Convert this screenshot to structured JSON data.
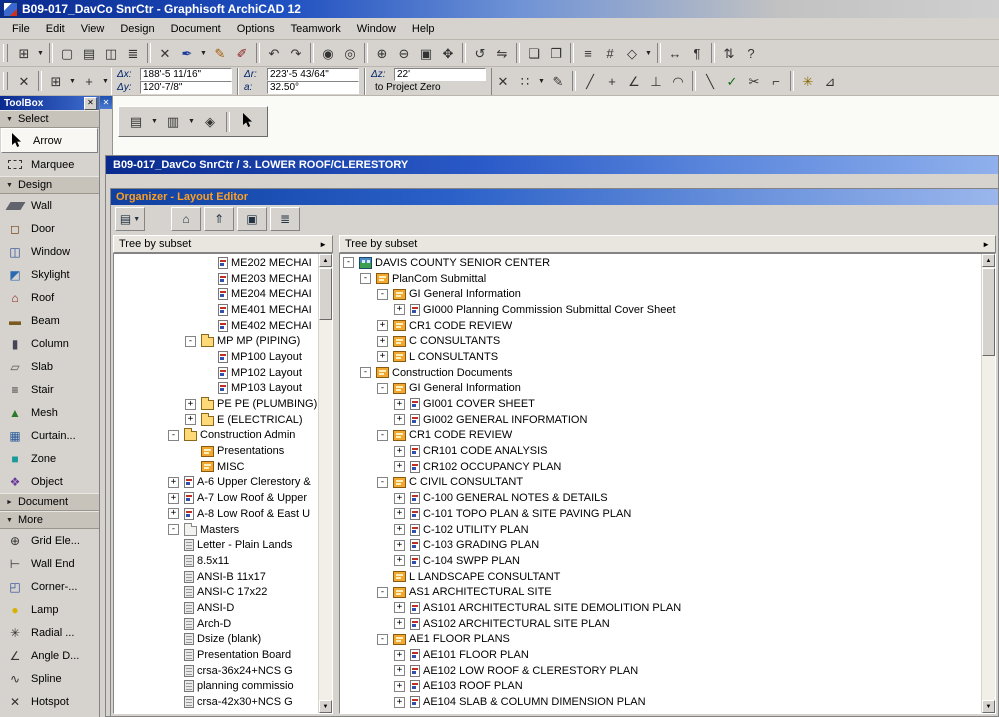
{
  "titlebar": {
    "title": "B09-017_DavCo SnrCtr - Graphisoft ArchiCAD 12"
  },
  "menubar": {
    "items": [
      "File",
      "Edit",
      "View",
      "Design",
      "Document",
      "Options",
      "Teamwork",
      "Window",
      "Help"
    ]
  },
  "toolbar_main": {
    "items": [
      {
        "icon": "favorites-grid-icon"
      },
      {
        "drop": true
      },
      {
        "sep": true
      },
      {
        "icon": "new-document-icon"
      },
      {
        "icon": "open-icon"
      },
      {
        "icon": "save-icon"
      },
      {
        "icon": "print-icon"
      },
      {
        "sep": true
      },
      {
        "icon": "delete-icon"
      },
      {
        "icon": "pen-color-icon"
      },
      {
        "drop": true
      },
      {
        "icon": "pencil-icon"
      },
      {
        "icon": "brush-icon"
      },
      {
        "sep": true
      },
      {
        "icon": "undo-icon"
      },
      {
        "icon": "redo-icon"
      },
      {
        "sep": true
      },
      {
        "icon": "pickup-parameters-icon"
      },
      {
        "icon": "inject-parameters-icon"
      },
      {
        "sep": true
      },
      {
        "icon": "zoom-in-icon"
      },
      {
        "icon": "zoom-out-icon"
      },
      {
        "icon": "fit-in-window-icon"
      },
      {
        "icon": "pan-icon"
      },
      {
        "sep": true
      },
      {
        "icon": "rotate-icon"
      },
      {
        "icon": "mirror-icon"
      },
      {
        "sep": true
      },
      {
        "icon": "group-icon"
      },
      {
        "icon": "ungroup-icon"
      },
      {
        "sep": true
      },
      {
        "icon": "layers-icon"
      },
      {
        "icon": "grid-icon"
      },
      {
        "icon": "snap-icon"
      },
      {
        "drop": true
      },
      {
        "sep": true
      },
      {
        "icon": "dimension-icon"
      },
      {
        "icon": "label-icon"
      },
      {
        "sep": true
      },
      {
        "icon": "teamwork-icon"
      },
      {
        "icon": "help-icon"
      }
    ]
  },
  "toolbar_coords": {
    "left_items": [
      {
        "icon": "close-icon"
      },
      {
        "sep": true
      },
      {
        "icon": "grid-snap-icon"
      },
      {
        "drop": true
      },
      {
        "icon": "plus-icon"
      },
      {
        "drop": true
      }
    ],
    "coord_boxes": [
      {
        "rows": [
          {
            "label": "Δx:",
            "value": "188'-5 11/16\""
          },
          {
            "label": "Δy:",
            "value": "120'-7/8\""
          }
        ]
      },
      {
        "rows": [
          {
            "label": "Δr:",
            "value": "223'-5 43/64\""
          },
          {
            "label": "a:",
            "value": "32.50°"
          }
        ]
      },
      {
        "rows": [
          {
            "label": "Δz:",
            "value": "22'"
          },
          {
            "label": "",
            "value": "to Project Zero",
            "plain": true
          }
        ]
      }
    ],
    "right_items": [
      {
        "icon": "cancel-icon"
      },
      {
        "icon": "snap-points-icon"
      },
      {
        "drop": true
      },
      {
        "icon": "pen-icon"
      },
      {
        "sep": true
      },
      {
        "icon": "guide-line-icon"
      },
      {
        "icon": "snap-point-icon"
      },
      {
        "icon": "angle-snap-icon"
      },
      {
        "icon": "perpendicular-icon"
      },
      {
        "icon": "tangent-icon"
      },
      {
        "sep": true
      },
      {
        "icon": "diagonal-icon"
      },
      {
        "icon": "ok-icon"
      },
      {
        "icon": "scissors-icon"
      },
      {
        "icon": "corner-icon"
      },
      {
        "sep": true
      },
      {
        "icon": "magic-wand-icon"
      },
      {
        "icon": "trim-icon"
      }
    ]
  },
  "mini_toolbar": {
    "items": [
      {
        "icon": "layout-settings-icon"
      },
      {
        "drop": true
      },
      {
        "icon": "master-layout-icon"
      },
      {
        "drop": true
      },
      {
        "icon": "update-icon"
      },
      {
        "sep": true
      },
      {
        "icon": "arrow-cursor-icon"
      }
    ]
  },
  "toolbox": {
    "title": "ToolBox",
    "items": [
      {
        "type": "header",
        "label": "Select"
      },
      {
        "type": "tool",
        "label": "Arrow",
        "icon": "arrow",
        "selected": true
      },
      {
        "type": "tool",
        "label": "Marquee",
        "icon": "marquee"
      },
      {
        "type": "header",
        "label": "Design"
      },
      {
        "type": "tool",
        "label": "Wall",
        "icon": "wall"
      },
      {
        "type": "tool",
        "label": "Door",
        "icon": "door"
      },
      {
        "type": "tool",
        "label": "Window",
        "icon": "window"
      },
      {
        "type": "tool",
        "label": "Skylight",
        "icon": "skylight"
      },
      {
        "type": "tool",
        "label": "Roof",
        "icon": "roof"
      },
      {
        "type": "tool",
        "label": "Beam",
        "icon": "beam"
      },
      {
        "type": "tool",
        "label": "Column",
        "icon": "column"
      },
      {
        "type": "tool",
        "label": "Slab",
        "icon": "slab"
      },
      {
        "type": "tool",
        "label": "Stair",
        "icon": "stair"
      },
      {
        "type": "tool",
        "label": "Mesh",
        "icon": "mesh"
      },
      {
        "type": "tool",
        "label": "Curtain...",
        "icon": "curtain"
      },
      {
        "type": "tool",
        "label": "Zone",
        "icon": "zone"
      },
      {
        "type": "tool",
        "label": "Object",
        "icon": "object"
      },
      {
        "type": "header",
        "label": "Document"
      },
      {
        "type": "header",
        "label": "More"
      },
      {
        "type": "tool",
        "label": "Grid Ele...",
        "icon": "grid-element"
      },
      {
        "type": "tool",
        "label": "Wall End",
        "icon": "wall-end"
      },
      {
        "type": "tool",
        "label": "Corner-...",
        "icon": "corner-window"
      },
      {
        "type": "tool",
        "label": "Lamp",
        "icon": "lamp"
      },
      {
        "type": "tool",
        "label": "Radial ...",
        "icon": "radial-dimension"
      },
      {
        "type": "tool",
        "label": "Angle D...",
        "icon": "angle-dimension"
      },
      {
        "type": "tool",
        "label": "Spline",
        "icon": "spline"
      },
      {
        "type": "tool",
        "label": "Hotspot",
        "icon": "hotspot"
      }
    ]
  },
  "document_window": {
    "title": "B09-017_DavCo SnrCtr / 3. LOWER ROOF/CLERESTORY"
  },
  "organizer": {
    "title": "Organizer - Layout Editor",
    "toolbar": {
      "items": [
        {
          "icon": "project-chooser-icon"
        },
        {
          "drop": true
        },
        {
          "gap": true
        },
        {
          "icon": "home-icon"
        },
        {
          "icon": "folder-up-icon"
        },
        {
          "icon": "new-folder-icon"
        },
        {
          "icon": "tree-view-icon"
        }
      ]
    },
    "left_panel": {
      "header": "Tree by subset",
      "items": [
        {
          "lvl": 5,
          "exp": "",
          "icon": "layout",
          "label": "ME202 MECHAI"
        },
        {
          "lvl": 5,
          "exp": "",
          "icon": "layout",
          "label": "ME203 MECHAI"
        },
        {
          "lvl": 5,
          "exp": "",
          "icon": "layout",
          "label": "ME204 MECHAI"
        },
        {
          "lvl": 5,
          "exp": "",
          "icon": "layout",
          "label": "ME401 MECHAI"
        },
        {
          "lvl": 5,
          "exp": "",
          "icon": "layout",
          "label": "ME402 MECHAI"
        },
        {
          "lvl": 4,
          "exp": "-",
          "icon": "folder",
          "label": "MP MP (PIPING)"
        },
        {
          "lvl": 5,
          "exp": "",
          "icon": "layout",
          "label": "MP100 Layout"
        },
        {
          "lvl": 5,
          "exp": "",
          "icon": "layout",
          "label": "MP102 Layout"
        },
        {
          "lvl": 5,
          "exp": "",
          "icon": "layout",
          "label": "MP103 Layout"
        },
        {
          "lvl": 4,
          "exp": "+",
          "icon": "folder",
          "label": "PE PE (PLUMBING)"
        },
        {
          "lvl": 4,
          "exp": "+",
          "icon": "folder",
          "label": "E (ELECTRICAL)"
        },
        {
          "lvl": 3,
          "exp": "-",
          "icon": "folder",
          "label": "Construction Admin"
        },
        {
          "lvl": 4,
          "exp": "",
          "icon": "subset",
          "label": "Presentations"
        },
        {
          "lvl": 4,
          "exp": "",
          "icon": "subset",
          "label": "MISC"
        },
        {
          "lvl": 3,
          "exp": "+",
          "icon": "layout",
          "label": "A-6 Upper Clerestory &"
        },
        {
          "lvl": 3,
          "exp": "+",
          "icon": "layout",
          "label": "A-7 Low Roof & Upper"
        },
        {
          "lvl": 3,
          "exp": "+",
          "icon": "layout",
          "label": "A-8 Low Roof & East U"
        },
        {
          "lvl": 3,
          "exp": "-",
          "icon": "masterfolder",
          "label": "Masters"
        },
        {
          "lvl": 3,
          "exp": "",
          "icon": "master",
          "label": "Letter - Plain Lands"
        },
        {
          "lvl": 3,
          "exp": "",
          "icon": "master",
          "label": "8.5x11"
        },
        {
          "lvl": 3,
          "exp": "",
          "icon": "master",
          "label": "ANSI-B 11x17"
        },
        {
          "lvl": 3,
          "exp": "",
          "icon": "master",
          "label": "ANSI-C 17x22"
        },
        {
          "lvl": 3,
          "exp": "",
          "icon": "master",
          "label": "ANSI-D"
        },
        {
          "lvl": 3,
          "exp": "",
          "icon": "master",
          "label": "Arch-D"
        },
        {
          "lvl": 3,
          "exp": "",
          "icon": "master",
          "label": "Dsize (blank)"
        },
        {
          "lvl": 3,
          "exp": "",
          "icon": "master",
          "label": "Presentation Board"
        },
        {
          "lvl": 3,
          "exp": "",
          "icon": "master",
          "label": "crsa-36x24+NCS G"
        },
        {
          "lvl": 3,
          "exp": "",
          "icon": "master",
          "label": "planning commissio"
        },
        {
          "lvl": 3,
          "exp": "",
          "icon": "master",
          "label": "crsa-42x30+NCS G"
        }
      ]
    },
    "right_panel": {
      "header": "Tree by subset",
      "items": [
        {
          "lvl": 0,
          "exp": "-",
          "icon": "project",
          "label": "DAVIS COUNTY SENIOR CENTER"
        },
        {
          "lvl": 1,
          "exp": "-",
          "icon": "subset",
          "label": "PlanCom Submittal"
        },
        {
          "lvl": 2,
          "exp": "-",
          "icon": "subset",
          "label": "GI General Information"
        },
        {
          "lvl": 3,
          "exp": "+",
          "icon": "layout",
          "label": "GI000 Planning Commission Submittal Cover Sheet"
        },
        {
          "lvl": 2,
          "exp": "+",
          "icon": "subset",
          "label": "CR1 CODE REVIEW"
        },
        {
          "lvl": 2,
          "exp": "+",
          "icon": "subset",
          "label": "C CONSULTANTS"
        },
        {
          "lvl": 2,
          "exp": "+",
          "icon": "subset",
          "label": "L CONSULTANTS"
        },
        {
          "lvl": 1,
          "exp": "-",
          "icon": "subset",
          "label": "Construction Documents"
        },
        {
          "lvl": 2,
          "exp": "-",
          "icon": "subset",
          "label": "GI General Information"
        },
        {
          "lvl": 3,
          "exp": "+",
          "icon": "layout",
          "label": "GI001 COVER SHEET"
        },
        {
          "lvl": 3,
          "exp": "+",
          "icon": "layout",
          "label": "GI002 GENERAL INFORMATION"
        },
        {
          "lvl": 2,
          "exp": "-",
          "icon": "subset",
          "label": "CR1 CODE REVIEW"
        },
        {
          "lvl": 3,
          "exp": "+",
          "icon": "layout",
          "label": "CR101 CODE ANALYSIS"
        },
        {
          "lvl": 3,
          "exp": "+",
          "icon": "layout",
          "label": "CR102 OCCUPANCY PLAN"
        },
        {
          "lvl": 2,
          "exp": "-",
          "icon": "subset",
          "label": "C CIVIL CONSULTANT"
        },
        {
          "lvl": 3,
          "exp": "+",
          "icon": "layout",
          "label": "C-100 GENERAL NOTES & DETAILS"
        },
        {
          "lvl": 3,
          "exp": "+",
          "icon": "layout",
          "label": "C-101 TOPO PLAN & SITE PAVING PLAN"
        },
        {
          "lvl": 3,
          "exp": "+",
          "icon": "layout",
          "label": "C-102 UTILITY PLAN"
        },
        {
          "lvl": 3,
          "exp": "+",
          "icon": "layout",
          "label": "C-103 GRADING PLAN"
        },
        {
          "lvl": 3,
          "exp": "+",
          "icon": "layout",
          "label": "C-104 SWPP PLAN"
        },
        {
          "lvl": 2,
          "exp": "",
          "icon": "subset",
          "label": "L LANDSCAPE CONSULTANT"
        },
        {
          "lvl": 2,
          "exp": "-",
          "icon": "subset",
          "label": "AS1 ARCHITECTURAL SITE"
        },
        {
          "lvl": 3,
          "exp": "+",
          "icon": "layout",
          "label": "AS101 ARCHITECTURAL SITE DEMOLITION PLAN"
        },
        {
          "lvl": 3,
          "exp": "+",
          "icon": "layout",
          "label": "AS102 ARCHITECTURAL SITE PLAN"
        },
        {
          "lvl": 2,
          "exp": "-",
          "icon": "subset",
          "label": "AE1 FLOOR PLANS"
        },
        {
          "lvl": 3,
          "exp": "+",
          "icon": "layout",
          "label": "AE101 FLOOR PLAN"
        },
        {
          "lvl": 3,
          "exp": "+",
          "icon": "layout",
          "label": "AE102 LOW ROOF & CLERESTORY PLAN"
        },
        {
          "lvl": 3,
          "exp": "+",
          "icon": "layout",
          "label": "AE103 ROOF PLAN"
        },
        {
          "lvl": 3,
          "exp": "+",
          "icon": "layout",
          "label": "AE104 SLAB & COLUMN DIMENSION PLAN"
        }
      ]
    }
  },
  "colors": {
    "titlebar_blue": "#0a2a8e",
    "organizer_title_text": "#ffa020",
    "ui_gray": "#d6d3ce",
    "subset_icon": "#f0a830",
    "layout_mark_red": "#c03020",
    "layout_mark_blue": "#3050b0"
  }
}
